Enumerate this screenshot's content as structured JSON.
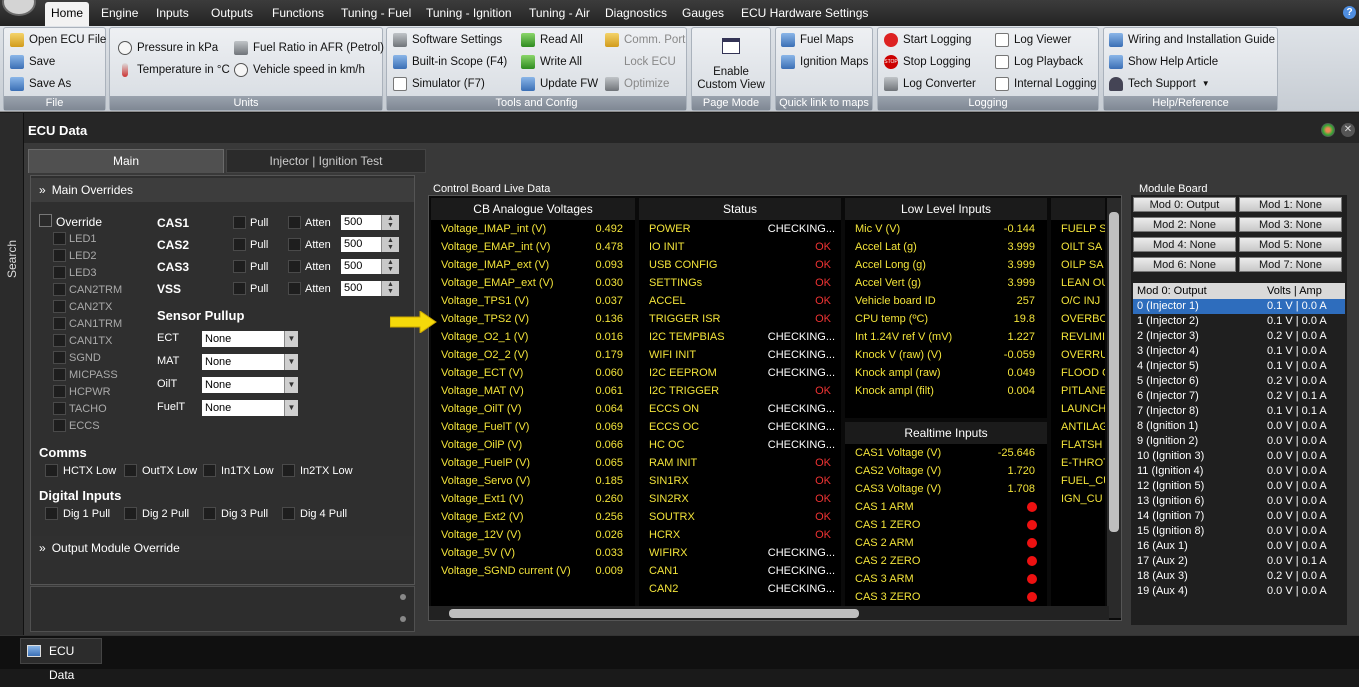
{
  "menu": {
    "tabs": [
      "Home",
      "Engine",
      "Inputs",
      "Outputs",
      "Functions",
      "Tuning - Fuel",
      "Tuning - Ignition",
      "Tuning - Air",
      "Diagnostics",
      "Gauges",
      "ECU Hardware Settings"
    ]
  },
  "ribbon": {
    "file": {
      "title": "File",
      "open": "Open ECU File",
      "save": "Save",
      "saveas": "Save As"
    },
    "units": {
      "title": "Units",
      "pressure": "Pressure in kPa",
      "temperature": "Temperature in °C",
      "fuel": "Fuel Ratio in AFR (Petrol)",
      "speed": "Vehicle speed in km/h"
    },
    "tools": {
      "title": "Tools and Config",
      "software": "Software Settings",
      "scope": "Built-in Scope (F4)",
      "simulator": "Simulator (F7)",
      "readall": "Read All",
      "writeall": "Write All",
      "update": "Update FW",
      "comport": "Comm. Port",
      "lock": "Lock ECU",
      "optimize": "Optimize"
    },
    "pagemode": {
      "title": "Page Mode",
      "enable": "Enable",
      "custom": "Custom View"
    },
    "quick": {
      "title": "Quick link to maps",
      "fuel": "Fuel Maps",
      "ign": "Ignition Maps"
    },
    "logging": {
      "title": "Logging",
      "start": "Start Logging",
      "stop": "Stop Logging",
      "converter": "Log Converter",
      "viewer": "Log Viewer",
      "playback": "Log Playback",
      "internal": "Internal Logging"
    },
    "help": {
      "title": "Help/Reference",
      "wiring": "Wiring and Installation Guide",
      "article": "Show Help Article",
      "tech": "Tech Support"
    }
  },
  "sidebar": {
    "search": "Search"
  },
  "window": {
    "title": "ECU Data",
    "tabs": [
      "Main",
      "Injector | Ignition Test"
    ]
  },
  "overrides": {
    "header": "Main Overrides",
    "override": "Override",
    "leds": [
      "LED1",
      "LED2",
      "LED3",
      "CAN2TRM",
      "CAN2TX",
      "CAN1TRM",
      "CAN1TX",
      "SGND",
      "MICPASS",
      "HCPWR",
      "TACHO",
      "ECCS"
    ],
    "cas": [
      {
        "name": "CAS1",
        "pull": "Pull",
        "atten": "Atten",
        "val": "500"
      },
      {
        "name": "CAS2",
        "pull": "Pull",
        "atten": "Atten",
        "val": "500"
      },
      {
        "name": "CAS3",
        "pull": "Pull",
        "atten": "Atten",
        "val": "500"
      },
      {
        "name": "VSS",
        "pull": "Pull",
        "atten": "Atten",
        "val": "500"
      }
    ],
    "pullup_title": "Sensor Pullup",
    "pullups": [
      {
        "name": "ECT",
        "val": "None"
      },
      {
        "name": "MAT",
        "val": "None"
      },
      {
        "name": "OilT",
        "val": "None"
      },
      {
        "name": "FuelT",
        "val": "None"
      }
    ],
    "comms_title": "Comms",
    "comms": [
      "HCTX Low",
      "OutTX Low",
      "In1TX Low",
      "In2TX Low"
    ],
    "digital_title": "Digital Inputs",
    "digital": [
      "Dig 1 Pull",
      "Dig 2 Pull",
      "Dig 3 Pull",
      "Dig 4 Pull"
    ],
    "output_header": "Output Module Override"
  },
  "control": {
    "title": "Control Board Live Data",
    "analogue": {
      "title": "CB Analogue Voltages",
      "rows": [
        [
          "Voltage_IMAP_int (V)",
          "0.492"
        ],
        [
          "Voltage_EMAP_int (V)",
          "0.478"
        ],
        [
          "Voltage_IMAP_ext (V)",
          "0.093"
        ],
        [
          "Voltage_EMAP_ext (V)",
          "0.030"
        ],
        [
          "Voltage_TPS1 (V)",
          "0.037"
        ],
        [
          "Voltage_TPS2 (V)",
          "0.136"
        ],
        [
          "Voltage_O2_1 (V)",
          "0.016"
        ],
        [
          "Voltage_O2_2 (V)",
          "0.179"
        ],
        [
          "Voltage_ECT (V)",
          "0.060"
        ],
        [
          "Voltage_MAT (V)",
          "0.061"
        ],
        [
          "Voltage_OilT (V)",
          "0.064"
        ],
        [
          "Voltage_FuelT (V)",
          "0.069"
        ],
        [
          "Voltage_OilP (V)",
          "0.066"
        ],
        [
          "Voltage_FuelP (V)",
          "0.065"
        ],
        [
          "Voltage_Servo (V)",
          "0.185"
        ],
        [
          "Voltage_Ext1 (V)",
          "0.260"
        ],
        [
          "Voltage_Ext2 (V)",
          "0.256"
        ],
        [
          "Voltage_12V (V)",
          "0.026"
        ],
        [
          "Voltage_5V (V)",
          "0.033"
        ],
        [
          "Voltage_SGND current (V)",
          "0.009"
        ]
      ]
    },
    "status": {
      "title": "Status",
      "rows": [
        [
          "POWER",
          "CHECKING..."
        ],
        [
          "IO INIT",
          "OK"
        ],
        [
          "USB CONFIG",
          "OK"
        ],
        [
          "SETTINGs",
          "OK"
        ],
        [
          "ACCEL",
          "OK"
        ],
        [
          "TRIGGER ISR",
          "OK"
        ],
        [
          "I2C TEMPBIAS",
          "CHECKING..."
        ],
        [
          "WIFI INIT",
          "CHECKING..."
        ],
        [
          "I2C EEPROM",
          "CHECKING..."
        ],
        [
          "I2C TRIGGER",
          "OK"
        ],
        [
          "ECCS ON",
          "CHECKING..."
        ],
        [
          "ECCS OC",
          "CHECKING..."
        ],
        [
          "HC OC",
          "CHECKING..."
        ],
        [
          "RAM INIT",
          "OK"
        ],
        [
          "SIN1RX",
          "OK"
        ],
        [
          "SIN2RX",
          "OK"
        ],
        [
          "SOUTRX",
          "OK"
        ],
        [
          "HCRX",
          "OK"
        ],
        [
          "WIFIRX",
          "CHECKING..."
        ],
        [
          "CAN1",
          "CHECKING..."
        ],
        [
          "CAN2",
          "CHECKING..."
        ]
      ]
    },
    "lowlevel": {
      "title": "Low Level Inputs",
      "rows": [
        [
          "Mic V (V)",
          "-0.144"
        ],
        [
          "Accel Lat (g)",
          "3.999"
        ],
        [
          "Accel Long (g)",
          "3.999"
        ],
        [
          "Accel Vert (g)",
          "3.999"
        ],
        [
          "Vehicle board ID",
          "257"
        ],
        [
          "CPU temp (ºC)",
          "19.8"
        ],
        [
          "Int 1.24V ref V (mV)",
          "1.227"
        ],
        [
          "Knock V (raw) (V)",
          "-0.059"
        ],
        [
          "Knock ampl (raw)",
          "0.049"
        ],
        [
          "Knock ampl (filt)",
          "0.004"
        ]
      ]
    },
    "realtime": {
      "title": "Realtime Inputs",
      "rows": [
        [
          "CAS1 Voltage (V)",
          "-25.646"
        ],
        [
          "CAS2 Voltage (V)",
          "1.720"
        ],
        [
          "CAS3 Voltage (V)",
          "1.708"
        ]
      ],
      "leds": [
        "CAS 1 ARM",
        "CAS 1 ZERO",
        "CAS 2 ARM",
        "CAS 2 ZERO",
        "CAS 3 ARM",
        "CAS 3 ZERO"
      ]
    },
    "fifth": [
      "FUELP S",
      "OILT SA",
      "OILP SA",
      "LEAN OU",
      "O/C INJ",
      "OVERBO",
      "REVLIMI",
      "OVERRU",
      "FLOOD C",
      "PITLANE",
      "LAUNCH",
      "ANTILAG",
      "FLATSH",
      "E-THROT",
      "FUEL_CU",
      "IGN_CU"
    ]
  },
  "module": {
    "title": "Module Board",
    "buttons": [
      "Mod 0: Output",
      "Mod 1: None",
      "Mod 2: None",
      "Mod 3: None",
      "Mod 4: None",
      "Mod 5: None",
      "Mod 6: None",
      "Mod 7: None"
    ],
    "col1": "Mod 0: Output",
    "col2": "Volts | Amp",
    "rows": [
      [
        "0 (Injector 1)",
        "0.1 V | 0.0 A"
      ],
      [
        "1 (Injector 2)",
        "0.1 V | 0.0 A"
      ],
      [
        "2 (Injector 3)",
        "0.2 V | 0.0 A"
      ],
      [
        "3 (Injector 4)",
        "0.1 V | 0.0 A"
      ],
      [
        "4 (Injector 5)",
        "0.1 V | 0.0 A"
      ],
      [
        "5 (Injector 6)",
        "0.2 V | 0.0 A"
      ],
      [
        "6 (Injector 7)",
        "0.2 V | 0.1 A"
      ],
      [
        "7 (Injector 8)",
        "0.1 V | 0.1 A"
      ],
      [
        "8 (Ignition 1)",
        "0.0 V | 0.0 A"
      ],
      [
        "9 (Ignition 2)",
        "0.0 V | 0.0 A"
      ],
      [
        "10 (Ignition 3)",
        "0.0 V | 0.0 A"
      ],
      [
        "11 (Ignition 4)",
        "0.0 V | 0.0 A"
      ],
      [
        "12 (Ignition 5)",
        "0.0 V | 0.0 A"
      ],
      [
        "13 (Ignition 6)",
        "0.0 V | 0.0 A"
      ],
      [
        "14 (Ignition 7)",
        "0.0 V | 0.0 A"
      ],
      [
        "15 (Ignition 8)",
        "0.0 V | 0.0 A"
      ],
      [
        "16 (Aux 1)",
        "0.0 V | 0.0 A"
      ],
      [
        "17 (Aux 2)",
        "0.0 V | 0.1 A"
      ],
      [
        "18 (Aux 3)",
        "0.2 V | 0.0 A"
      ],
      [
        "19 (Aux 4)",
        "0.0 V | 0.0 A"
      ]
    ]
  },
  "taskbar": {
    "item": "ECU Data"
  }
}
